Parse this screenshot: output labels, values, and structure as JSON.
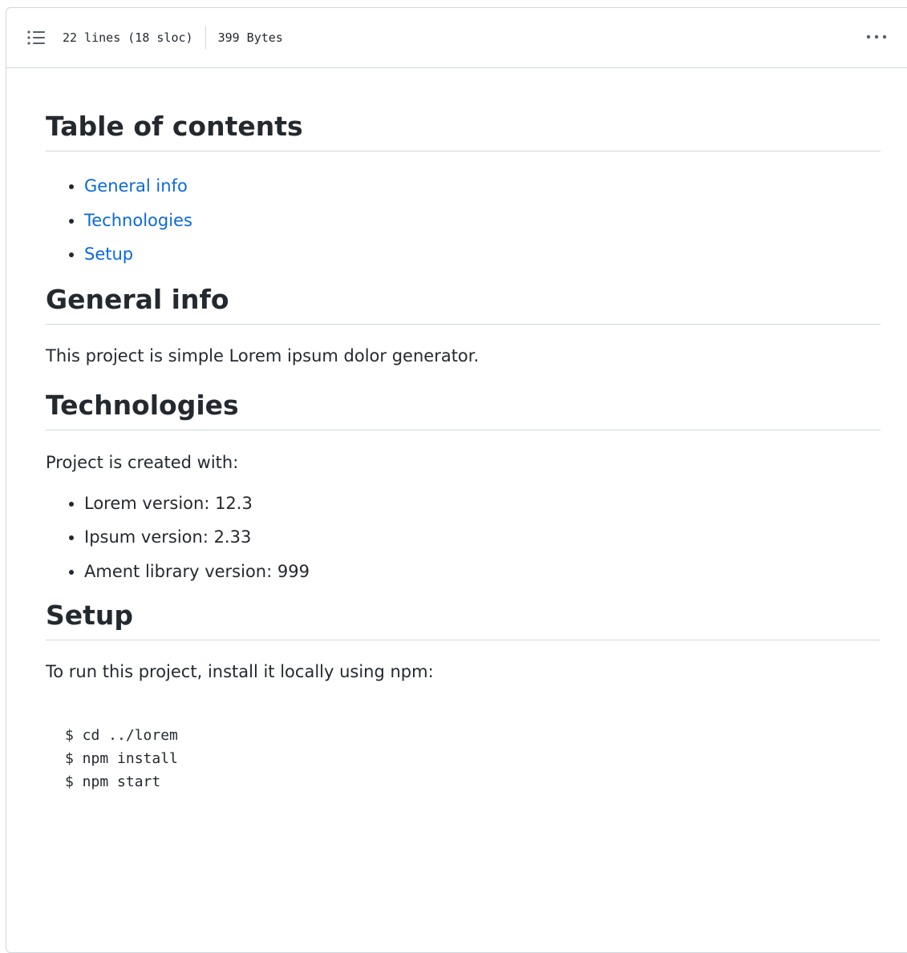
{
  "header": {
    "toc_icon": "list-unordered-icon",
    "lines_info": "22 lines (18 sloc)",
    "size_info": "399 Bytes",
    "more_icon": "kebab-horizontal-icon"
  },
  "readme": {
    "toc_heading": "Table of contents",
    "toc_items": [
      "General info",
      "Technologies",
      "Setup"
    ],
    "general": {
      "heading": "General info",
      "text": "This project is simple Lorem ipsum dolor generator."
    },
    "technologies": {
      "heading": "Technologies",
      "intro": "Project is created with:",
      "items": [
        "Lorem version: 12.3",
        "Ipsum version: 2.33",
        "Ament library version: 999"
      ]
    },
    "setup": {
      "heading": "Setup",
      "text": "To run this project, install it locally using npm:",
      "code_lines": [
        "$ cd ../lorem",
        "$ npm install",
        "$ npm start"
      ]
    }
  },
  "colors": {
    "link": "#0969da",
    "text": "#24292f",
    "border": "#d0d7de"
  }
}
